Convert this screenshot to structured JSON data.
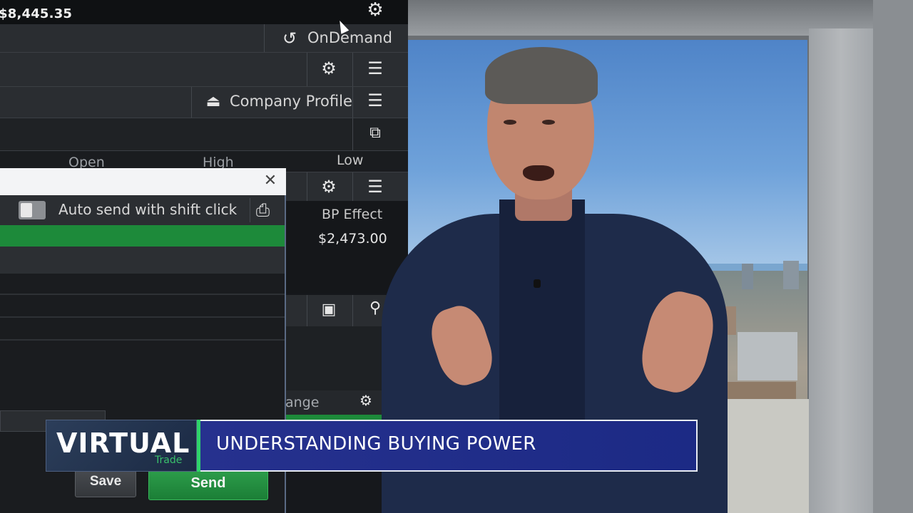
{
  "platform": {
    "account_balance": "$8,445.35",
    "ondemand_label": "OnDemand",
    "company_profile_label": "Company Profile",
    "columns": {
      "open": "Open",
      "high": "High",
      "low": "Low"
    },
    "order_entry": {
      "auto_send_label": "Auto send with shift click",
      "bp_effect_label": "BP Effect",
      "bp_effect_value": "$2,473.00",
      "change_label": "ange",
      "save_label": "Save",
      "send_label": "Send"
    }
  },
  "lower_third": {
    "brand": "VIRTUAL",
    "brand_sub": "Trade",
    "headline": "UNDERSTANDING BUYING POWER"
  },
  "colors": {
    "brand_green": "#2ed36a",
    "headline_blue": "#26318e",
    "platform_green": "#1d8a3a"
  },
  "icons": [
    "gear-icon",
    "ondemand-icon",
    "list-icon",
    "eject-icon",
    "popout-icon",
    "close-icon",
    "print-icon",
    "camera-icon",
    "pin-icon",
    "settings-icon"
  ]
}
